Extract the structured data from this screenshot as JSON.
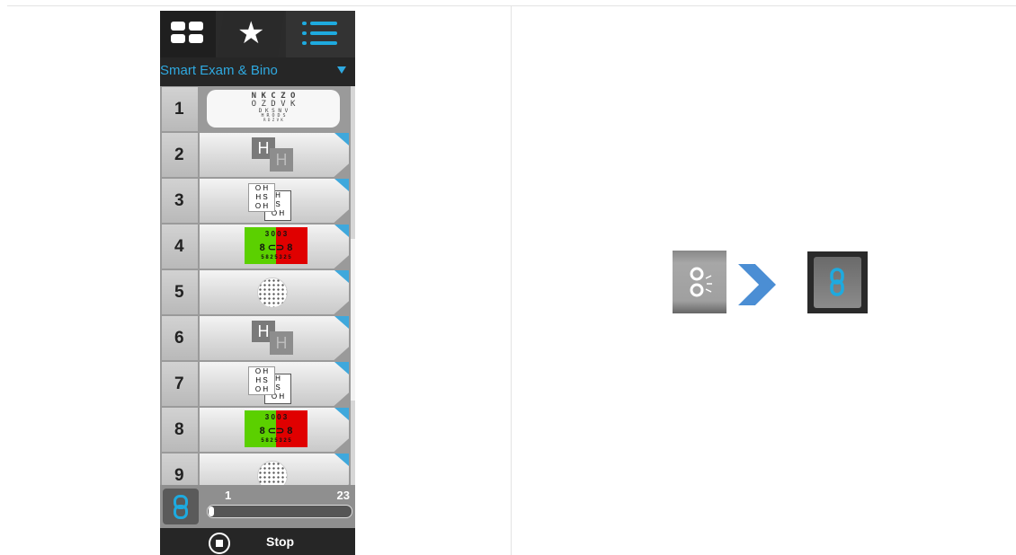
{
  "tabs": [
    {
      "icon": "grid-icon"
    },
    {
      "icon": "star-icon"
    },
    {
      "icon": "list-icon",
      "active": true
    }
  ],
  "program": {
    "selected": "Smart Exam & Bino"
  },
  "tests": [
    {
      "number": "1",
      "chart": "snellen",
      "lines": [
        "N K C Z O",
        "O Z D V K",
        "D K S N V",
        "H R O D S",
        "R D Z V K",
        "O H D K S"
      ]
    },
    {
      "number": "2",
      "chart": "h-polarized",
      "letter": "H"
    },
    {
      "number": "3",
      "chart": "fixation-disparity",
      "text_a": "O H\nH S\nO H",
      "text_b": "H\nS\nO H"
    },
    {
      "number": "4",
      "chart": "red-green",
      "top": "3 0   0 3",
      "mid": "8 ⊂⊃ 8",
      "bot": "5 8 2 5 3 2 5"
    },
    {
      "number": "5",
      "chart": "dot-circle"
    },
    {
      "number": "6",
      "chart": "h-polarized",
      "letter": "H"
    },
    {
      "number": "7",
      "chart": "fixation-disparity",
      "text_a": "O H\nH S\nO H",
      "text_b": "H\nS\nO H"
    },
    {
      "number": "8",
      "chart": "red-green",
      "top": "3 0   0 3",
      "mid": "8 ⊂⊃ 8",
      "bot": "5 8 2 5 3 2 5"
    },
    {
      "number": "9",
      "chart": "dot-circle"
    }
  ],
  "progress": {
    "start": "1",
    "end": "23",
    "current": 1,
    "fraction": 0.02
  },
  "stop": {
    "label": "Stop"
  },
  "illustration": {
    "from_icon": "unlink-icon",
    "arrow_icon": "chevron-right-icon",
    "to_icon": "link-icon"
  },
  "colors": {
    "accent": "#1eaadf",
    "green": "#5bd000",
    "red": "#e00000"
  }
}
